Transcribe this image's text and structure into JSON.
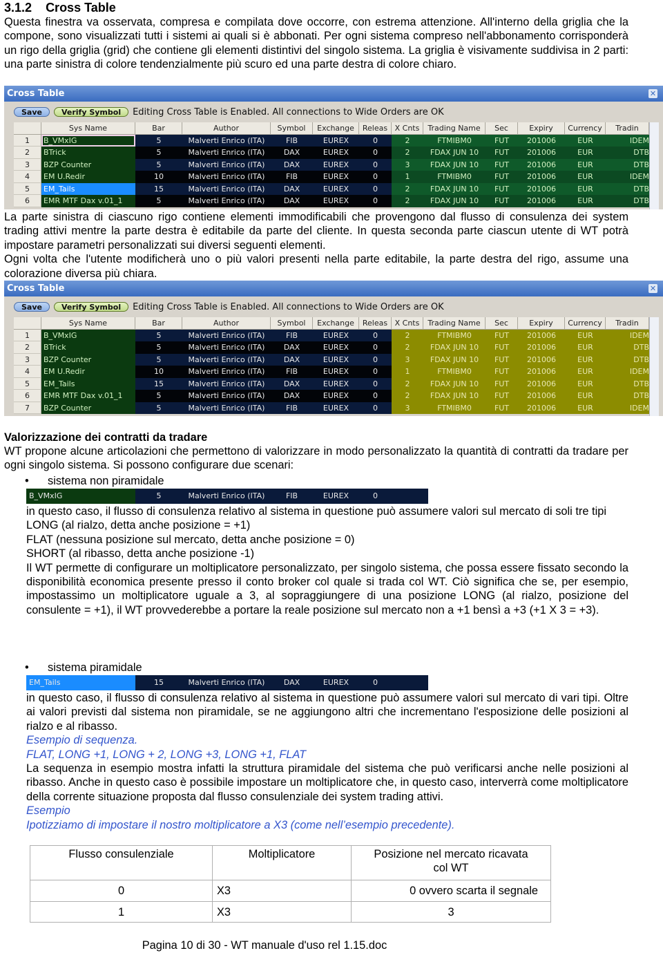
{
  "section": {
    "number": "3.1.2",
    "title": "Cross Table"
  },
  "para1": "Questa finestra va osservata, compresa e compilata dove occorre, con estrema attenzione. All'interno della griglia che la compone, sono visualizzati tutti i sistemi ai quali si è abbonati.  Per ogni sistema compreso nell'abbonamento corrisponderà un rigo della griglia (grid) che contiene gli elementi distintivi del singolo sistema. La griglia è visivamente suddivisa in 2 parti: una parte sinistra di colore tendenzialmente più scuro ed una parte destra di colore chiaro.",
  "para2": "La parte sinistra di ciascuno rigo contiene elementi immodificabili che provengono dal flusso di consulenza dei system trading attivi mentre la parte destra è editabile da parte del cliente. In questa seconda parte ciascun utente di WT potrà impostare parametri personalizzati sui diversi seguenti elementi.",
  "para3": "Ogni volta che l'utente modificherà uno o più valori presenti nella parte editabile, la parte destra del rigo, assume una colorazione diversa più chiara.",
  "window": {
    "title": "Cross Table",
    "save": "Save",
    "verify": "Verify Symbol",
    "status": "Editing Cross Table is Enabled. All connections to Wide Orders are OK",
    "columns": [
      "",
      "Sys Name",
      "Bar",
      "Author",
      "Symbol",
      "Exchange",
      "Releas",
      "X Cnts",
      "Trading Name",
      "Sec",
      "Expiry",
      "Currency",
      "Tradin"
    ],
    "rows": [
      [
        "1",
        "B_VMxIG",
        "5",
        "Malverti Enrico (ITA)",
        "FIB",
        "EUREX",
        "0",
        "2",
        "FTMIBM0",
        "FUT",
        "201006",
        "EUR",
        "IDEM"
      ],
      [
        "2",
        "BTrick",
        "5",
        "Malverti Enrico (ITA)",
        "DAX",
        "EUREX",
        "0",
        "2",
        "FDAX JUN 10",
        "FUT",
        "201006",
        "EUR",
        "DTB"
      ],
      [
        "3",
        "BZP Counter",
        "5",
        "Malverti Enrico (ITA)",
        "DAX",
        "EUREX",
        "0",
        "3",
        "FDAX JUN 10",
        "FUT",
        "201006",
        "EUR",
        "DTB"
      ],
      [
        "4",
        "EM U.Redir",
        "10",
        "Malverti Enrico (ITA)",
        "FIB",
        "EUREX",
        "0",
        "1",
        "FTMIBM0",
        "FUT",
        "201006",
        "EUR",
        "IDEM"
      ],
      [
        "5",
        "EM_Tails",
        "15",
        "Malverti Enrico (ITA)",
        "DAX",
        "EUREX",
        "0",
        "2",
        "FDAX JUN 10",
        "FUT",
        "201006",
        "EUR",
        "DTB"
      ],
      [
        "6",
        "EMR MTF Dax v.01_1",
        "5",
        "Malverti Enrico (ITA)",
        "DAX",
        "EUREX",
        "0",
        "2",
        "FDAX JUN 10",
        "FUT",
        "201006",
        "EUR",
        "DTB"
      ],
      [
        "7",
        "BZP Counter",
        "5",
        "Malverti Enrico (ITA)",
        "FIB",
        "EUREX",
        "0",
        "3",
        "FTMIBM0",
        "FUT",
        "201006",
        "EUR",
        "IDEM"
      ]
    ]
  },
  "colors": {
    "default_right": "#0f5a2a",
    "modified_right": "#8c8c00",
    "selected_row": "#1a8cff"
  },
  "valorizzazione": {
    "title": "Valorizzazione dei contratti da tradare",
    "intro": "WT propone alcune articolazioni che permettono di valorizzare in modo personalizzato la quantità di contratti da tradare per ogni singolo sistema. Si possono configurare due scenari:",
    "bullet1": "sistema non piramidale",
    "strip1": [
      "B_VMxIG",
      "5",
      "Malverti Enrico (ITA)",
      "FIB",
      "EUREX",
      "0"
    ],
    "text1": "in questo caso, il flusso di consulenza relativo al sistema in questione può assumere valori sul mercato di soli tre tipi",
    "long": "LONG (al rialzo, detta anche posizione = +1)",
    "flat": "FLAT (nessuna posizione sul mercato, detta anche posizione = 0)",
    "short": "SHORT (al ribasso, detta anche posizione -1)",
    "text2": "Il WT permette di configurare un moltiplicatore personalizzato, per singolo sistema, che possa essere fissato secondo la  disponibilità economica presente presso il conto broker col quale si trada col WT. Ciò significa che se, per esempio, impostassimo un moltiplicatore uguale a 3, al sopraggiungere di una posizione LONG (al rialzo, posizione del consulente  = +1), il WT provvederebbe a portare la reale posizione sul mercato non a +1 bensì a +3   (+1 X 3 = +3).",
    "bullet2": "sistema piramidale",
    "strip2": [
      "EM_Tails",
      "15",
      "Malverti Enrico (ITA)",
      "DAX",
      "EUREX",
      "0"
    ],
    "text3": "in questo caso, il flusso di consulenza relativo al sistema in questione può assumere valori sul mercato di vari tipi. Oltre ai valori previsti dal sistema non piramidale, se ne aggiungono altri che incrementano l'esposizione delle posizioni al rialzo e al ribasso.",
    "example1": "Esempio di sequenza.",
    "sequence": "FLAT, LONG +1, LONG + 2, LONG +3, LONG +1, FLAT",
    "text4": "La sequenza in esempio mostra infatti la struttura piramidale del sistema che può verificarsi anche nelle posizioni al ribasso. Anche in questo caso è possibile impostare un moltiplicatore che, in questo caso, interverrà come moltiplicatore della corrente situazione proposta dal flusso consulenziale dei system trading attivi.",
    "example2": "Esempio",
    "example2_text": "Ipotizziamo di impostare il nostro moltiplicatore a X3 (come nell’esempio precedente).",
    "table": {
      "headers": [
        "Flusso consulenziale",
        "Moltiplicatore",
        "Posizione nel mercato ricavata col WT"
      ],
      "rows": [
        [
          "0",
          "X3",
          "0 ovvero scarta il segnale"
        ],
        [
          "1",
          "X3",
          "3"
        ]
      ]
    }
  },
  "footer": "Pagina 10 di 30 - WT manuale d'uso rel 1.15.doc"
}
